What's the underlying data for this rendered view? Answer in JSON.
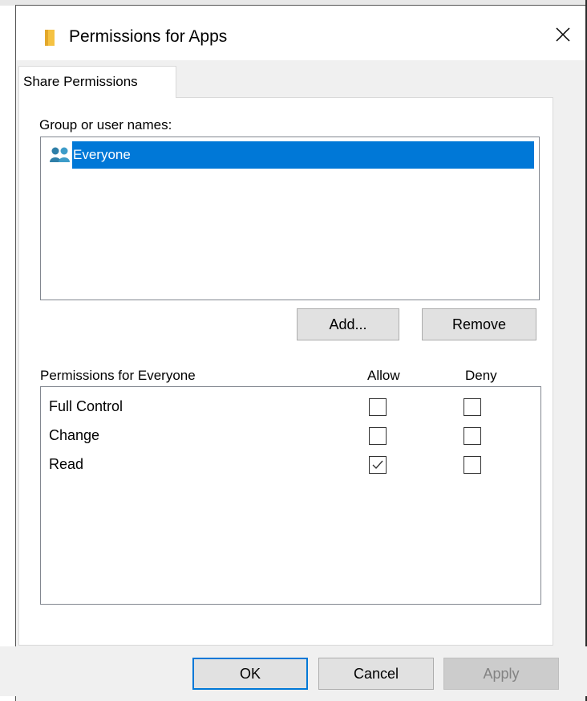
{
  "window": {
    "title": "Permissions for Apps",
    "title_icon": "folder-icon",
    "close_icon": "close-icon"
  },
  "tabs": [
    {
      "label": "Share Permissions",
      "selected": true
    }
  ],
  "group_section": {
    "label": "Group or user names:",
    "items": [
      {
        "name": "Everyone",
        "icon": "users-group-icon",
        "selected": true
      }
    ],
    "add_label": "Add...",
    "remove_label": "Remove"
  },
  "permissions_section": {
    "header": "Permissions for Everyone",
    "allow_header": "Allow",
    "deny_header": "Deny",
    "rows": [
      {
        "name": "Full Control",
        "allow": false,
        "deny": false
      },
      {
        "name": "Change",
        "allow": false,
        "deny": false
      },
      {
        "name": "Read",
        "allow": true,
        "deny": false
      }
    ]
  },
  "footer": {
    "ok_label": "OK",
    "cancel_label": "Cancel",
    "apply_label": "Apply",
    "apply_enabled": false
  },
  "colors": {
    "selection": "#0078d7",
    "dialog_bg": "#f0f0f0",
    "button_bg": "#e1e1e1",
    "folder": "#f5c242"
  }
}
